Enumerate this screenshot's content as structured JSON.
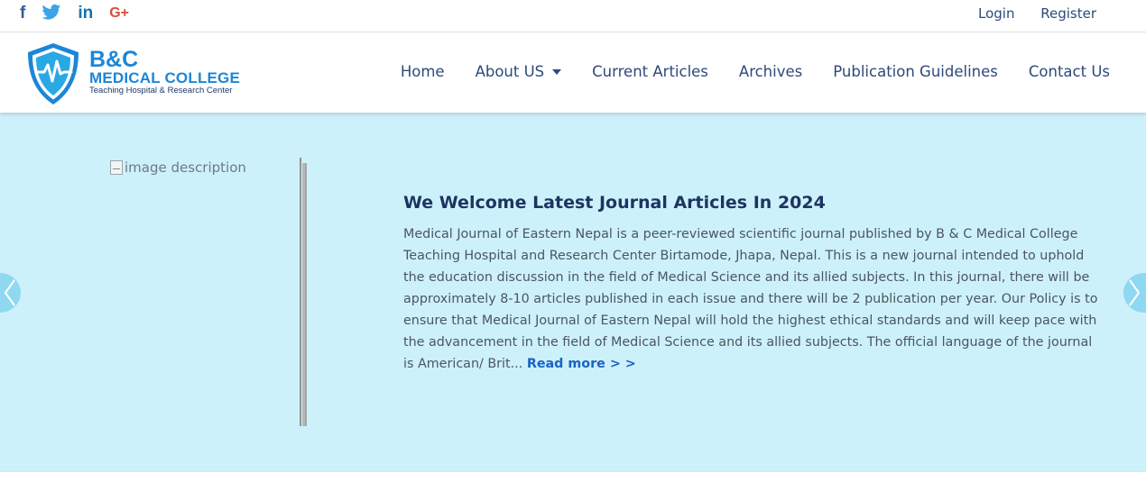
{
  "social": {
    "facebook": "f",
    "twitter_icon": "twitter-bird-icon",
    "linkedin": "in",
    "googleplus": "G+"
  },
  "auth": {
    "login": "Login",
    "register": "Register"
  },
  "logo": {
    "brand": "B&C",
    "name": "MEDICAL COLLEGE",
    "tagline": "Teaching Hospital & Research Center"
  },
  "nav": {
    "items": [
      "Home",
      "About US",
      "Current Articles",
      "Archives",
      "Publication Guidelines",
      "Contact Us"
    ]
  },
  "hero": {
    "image_alt": "image description",
    "title": "We Welcome Latest Journal Articles In 2024",
    "body": "Medical Journal of Eastern Nepal is a peer-reviewed scientific journal published by B & C Medical College Teaching Hospital and Research Center Birtamode, Jhapa, Nepal. This is a new journal intended to uphold the education discussion in the field of Medical Science and its allied subjects. In this journal, there will be approximately 8-10 articles published in each issue and there will be 2 publication per year. Our Policy is to ensure that Medical Journal of Eastern Nepal will hold the highest ethical standards and will keep pace with the advancement in the field of Medical Science and its allied subjects. The official language of the journal is American/ Brit...",
    "read_more": "Read more > >"
  },
  "colors": {
    "hero_bg": "#cdf1fb",
    "brand_blue": "#1c86d8",
    "nav_text": "#2d4a7a",
    "heading": "#1e3460",
    "link": "#1a63c4"
  }
}
